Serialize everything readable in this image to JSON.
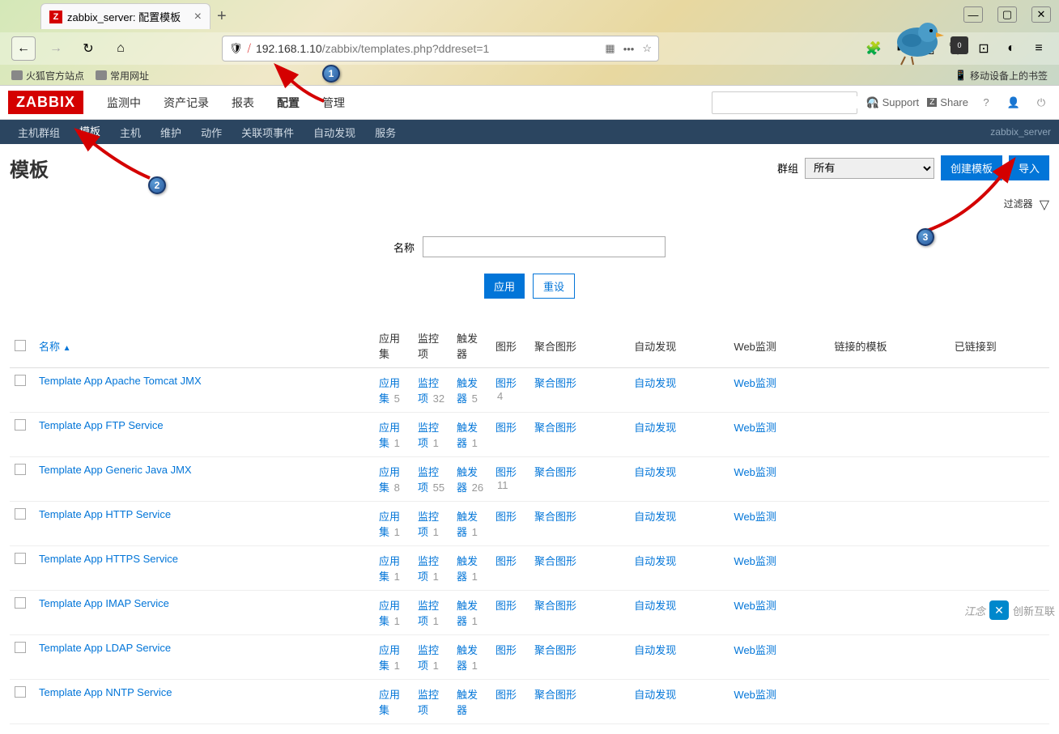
{
  "browser": {
    "tab_title": "zabbix_server: 配置模板",
    "url_host": "192.168.1.10",
    "url_path": "/zabbix/templates.php?ddreset=1",
    "bookmarks": {
      "firefox": "火狐官方站点",
      "common": "常用网址",
      "mobile": "移动设备上的书签"
    }
  },
  "zabbix": {
    "logo": "ZABBIX",
    "main_nav": {
      "monitoring": "监测中",
      "inventory": "资产记录",
      "reports": "报表",
      "configuration": "配置",
      "administration": "管理"
    },
    "header_right": {
      "support": "Support",
      "share": "Share"
    },
    "sub_nav": {
      "hostgroups": "主机群组",
      "templates": "模板",
      "hosts": "主机",
      "maintenance": "维护",
      "actions": "动作",
      "correlation": "关联项事件",
      "discovery": "自动发现",
      "services": "服务",
      "server": "zabbix_server"
    },
    "page_title": "模板",
    "group_label": "群组",
    "group_value": "所有",
    "btn_create": "创建模板",
    "btn_import": "导入",
    "filter": {
      "name_label": "名称",
      "apply": "应用",
      "reset": "重设"
    },
    "table": {
      "headers": {
        "name": "名称",
        "applications": "应用集",
        "items": "监控项",
        "triggers": "触发器",
        "graphs": "图形",
        "screens": "聚合图形",
        "discovery": "自动发现",
        "web": "Web监测",
        "linked": "链接的模板",
        "linkedto": "已链接到"
      },
      "link_labels": {
        "applications": "应用集",
        "items": "监控项",
        "triggers": "触发器",
        "graphs": "图形",
        "screens": "聚合图形",
        "discovery": "自动发现",
        "web": "Web监测"
      },
      "rows": [
        {
          "name": "Template App Apache Tomcat JMX",
          "apps": 5,
          "items": 32,
          "triggers": 5,
          "graphs": 4,
          "screens": "",
          "discovery": "",
          "web": ""
        },
        {
          "name": "Template App FTP Service",
          "apps": 1,
          "items": 1,
          "triggers": 1,
          "graphs": "",
          "screens": "",
          "discovery": "",
          "web": ""
        },
        {
          "name": "Template App Generic Java JMX",
          "apps": 8,
          "items": 55,
          "triggers": 26,
          "graphs": 11,
          "screens": "",
          "discovery": "",
          "web": ""
        },
        {
          "name": "Template App HTTP Service",
          "apps": 1,
          "items": 1,
          "triggers": 1,
          "graphs": "",
          "screens": "",
          "discovery": "",
          "web": ""
        },
        {
          "name": "Template App HTTPS Service",
          "apps": 1,
          "items": 1,
          "triggers": 1,
          "graphs": "",
          "screens": "",
          "discovery": "",
          "web": ""
        },
        {
          "name": "Template App IMAP Service",
          "apps": 1,
          "items": 1,
          "triggers": 1,
          "graphs": "",
          "screens": "",
          "discovery": "",
          "web": ""
        },
        {
          "name": "Template App LDAP Service",
          "apps": 1,
          "items": 1,
          "triggers": 1,
          "graphs": "",
          "screens": "",
          "discovery": "",
          "web": ""
        },
        {
          "name": "Template App NNTP Service",
          "apps": "",
          "items": "",
          "triggers": "",
          "graphs": "",
          "screens": "",
          "discovery": "",
          "web": ""
        }
      ]
    }
  },
  "watermark": {
    "text1": "江念",
    "text2": "创新互联"
  },
  "annotations": {
    "b1": "1",
    "b2": "2",
    "b3": "3"
  }
}
